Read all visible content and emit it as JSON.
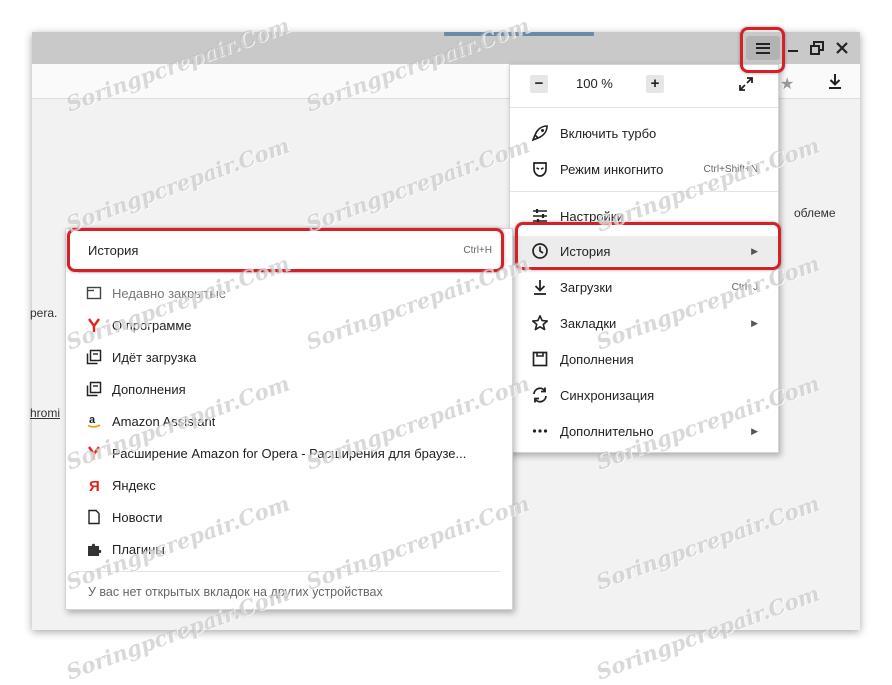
{
  "watermark": "Soringpcrepair.Com",
  "window": {
    "page_text_right": "облеме",
    "page_text_left": "pera.",
    "page_link": "hromi"
  },
  "main_menu": {
    "zoom": {
      "value": "100 %",
      "minus": "−",
      "plus": "+"
    },
    "turbo": "Включить турбо",
    "incognito": {
      "label": "Режим инкогнито",
      "shortcut": "Ctrl+Shift+N"
    },
    "settings": "Настройки",
    "history": "История",
    "downloads": {
      "label": "Загрузки",
      "shortcut": "Ctrl+J"
    },
    "bookmarks": "Закладки",
    "addons": "Дополнения",
    "sync": "Синхронизация",
    "more": "Дополнительно"
  },
  "history_menu": {
    "header": {
      "label": "История",
      "shortcut": "Ctrl+H"
    },
    "items": [
      {
        "label": "Недавно закрытые",
        "icon": "tab-icon"
      },
      {
        "label": "О программе",
        "icon": "yandex-y-icon"
      },
      {
        "label": "Идёт загрузка",
        "icon": "pages-icon"
      },
      {
        "label": "Дополнения",
        "icon": "pages-icon"
      },
      {
        "label": "Amazon Assistant",
        "icon": "amazon-icon"
      },
      {
        "label": "Расширение Amazon for Opera - Расширения для браузе...",
        "icon": "yandex-y-icon"
      },
      {
        "label": "Яндекс",
        "icon": "yandex-ya-icon"
      },
      {
        "label": "Новости",
        "icon": "page-icon"
      },
      {
        "label": "Плагины",
        "icon": "puzzle-icon"
      }
    ],
    "footer": "У вас нет открытых вкладок на других устройствах"
  },
  "colors": {
    "highlight": "#d61f26",
    "yandex_red": "#e0261b"
  }
}
